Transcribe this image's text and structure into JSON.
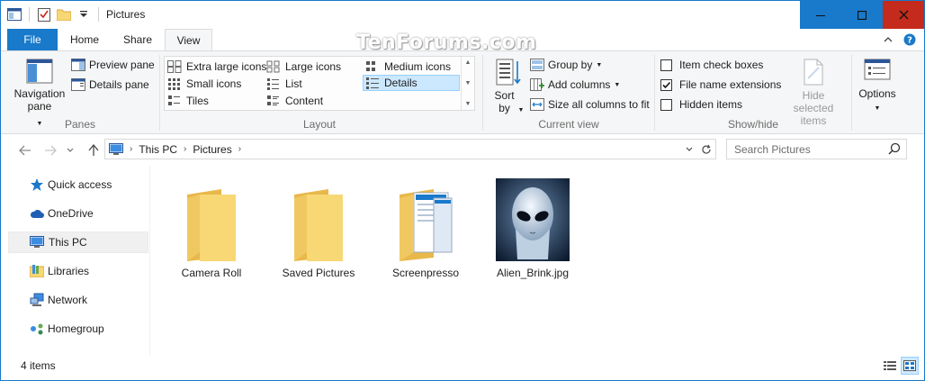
{
  "window": {
    "title": "Pictures",
    "accent_color": "#1979ca",
    "close_color": "#c42b1c"
  },
  "quick_access_toolbar": {
    "icons": [
      "window-icon",
      "properties-icon",
      "new-folder-icon",
      "customize-dropdown-icon"
    ]
  },
  "watermark": "TenForums.com",
  "ribbon_tabs": [
    {
      "label": "File"
    },
    {
      "label": "Home"
    },
    {
      "label": "Share"
    },
    {
      "label": "View"
    }
  ],
  "ribbon": {
    "panes": {
      "navigation_pane": "Navigation pane",
      "preview_pane": "Preview pane",
      "details_pane": "Details pane",
      "group_label": "Panes"
    },
    "layout": {
      "items": [
        "Extra large icons",
        "Large icons",
        "Medium icons",
        "Small icons",
        "List",
        "Details",
        "Tiles",
        "Content"
      ],
      "selected": "Details",
      "group_label": "Layout"
    },
    "current_view": {
      "sort_by": "Sort by",
      "group_by": "Group by",
      "add_columns": "Add columns",
      "size_all_columns": "Size all columns to fit",
      "group_label": "Current view"
    },
    "show_hide": {
      "item_check_boxes": "Item check boxes",
      "item_check_boxes_checked": false,
      "file_name_extensions": "File name extensions",
      "file_name_extensions_checked": true,
      "hidden_items": "Hidden items",
      "hidden_items_checked": false,
      "hide_selected_items": "Hide selected items",
      "group_label": "Show/hide"
    },
    "options": "Options"
  },
  "address_bar": {
    "crumbs": [
      "This PC",
      "Pictures"
    ],
    "search_placeholder": "Search Pictures"
  },
  "nav_pane": {
    "items": [
      {
        "label": "Quick access",
        "icon": "star-icon",
        "selected": false
      },
      {
        "label": "OneDrive",
        "icon": "cloud-icon",
        "selected": false
      },
      {
        "label": "This PC",
        "icon": "computer-icon",
        "selected": true
      },
      {
        "label": "Libraries",
        "icon": "libraries-icon",
        "selected": false
      },
      {
        "label": "Network",
        "icon": "network-icon",
        "selected": false
      },
      {
        "label": "Homegroup",
        "icon": "homegroup-icon",
        "selected": false
      }
    ]
  },
  "files": [
    {
      "name": "Camera Roll",
      "type": "folder"
    },
    {
      "name": "Saved Pictures",
      "type": "folder"
    },
    {
      "name": "Screenpresso",
      "type": "folder-with-content"
    },
    {
      "name": "Alien_Brink.jpg",
      "type": "image"
    }
  ],
  "status": {
    "count": "4 items"
  }
}
